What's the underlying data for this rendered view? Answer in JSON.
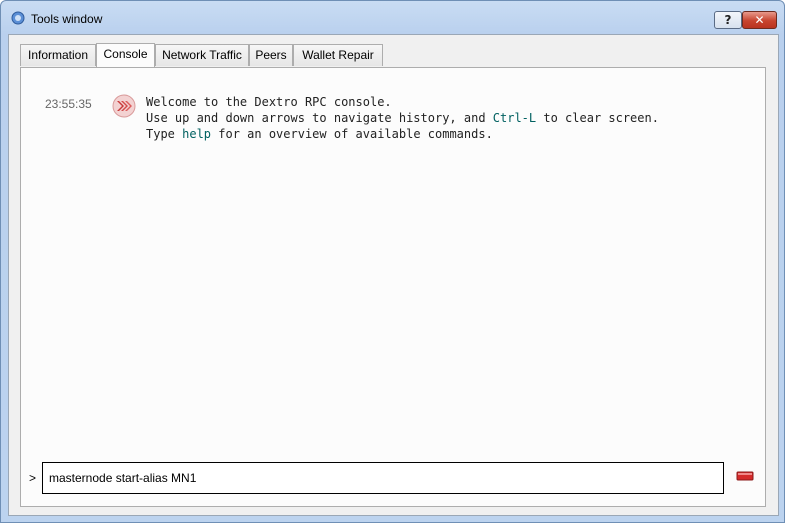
{
  "window": {
    "title": "Tools window",
    "help_label": "?",
    "close_label": "✕"
  },
  "tabs": [
    {
      "label": "Information",
      "active": false
    },
    {
      "label": "Console",
      "active": true
    },
    {
      "label": "Network Traffic",
      "active": false
    },
    {
      "label": "Peers",
      "active": false
    },
    {
      "label": "Wallet Repair",
      "active": false
    }
  ],
  "console": {
    "timestamp": "23:55:35",
    "line1": "Welcome to the Dextro RPC console.",
    "line2_pre": "Use up and down arrows to navigate history, and ",
    "line2_kw": "Ctrl-L",
    "line2_post": " to clear screen.",
    "line3_pre": "Type ",
    "line3_kw": "help",
    "line3_post": " for an overview of available commands.",
    "prompt": ">",
    "input_value": "masternode start-alias MN1"
  },
  "icons": {
    "app": "app-logo-icon",
    "message": "dextro-logo-icon",
    "clear": "clear-console-icon"
  },
  "colors": {
    "keyword": "#006060",
    "close_button": "#c7432e",
    "clear_icon": "#cc2222"
  }
}
